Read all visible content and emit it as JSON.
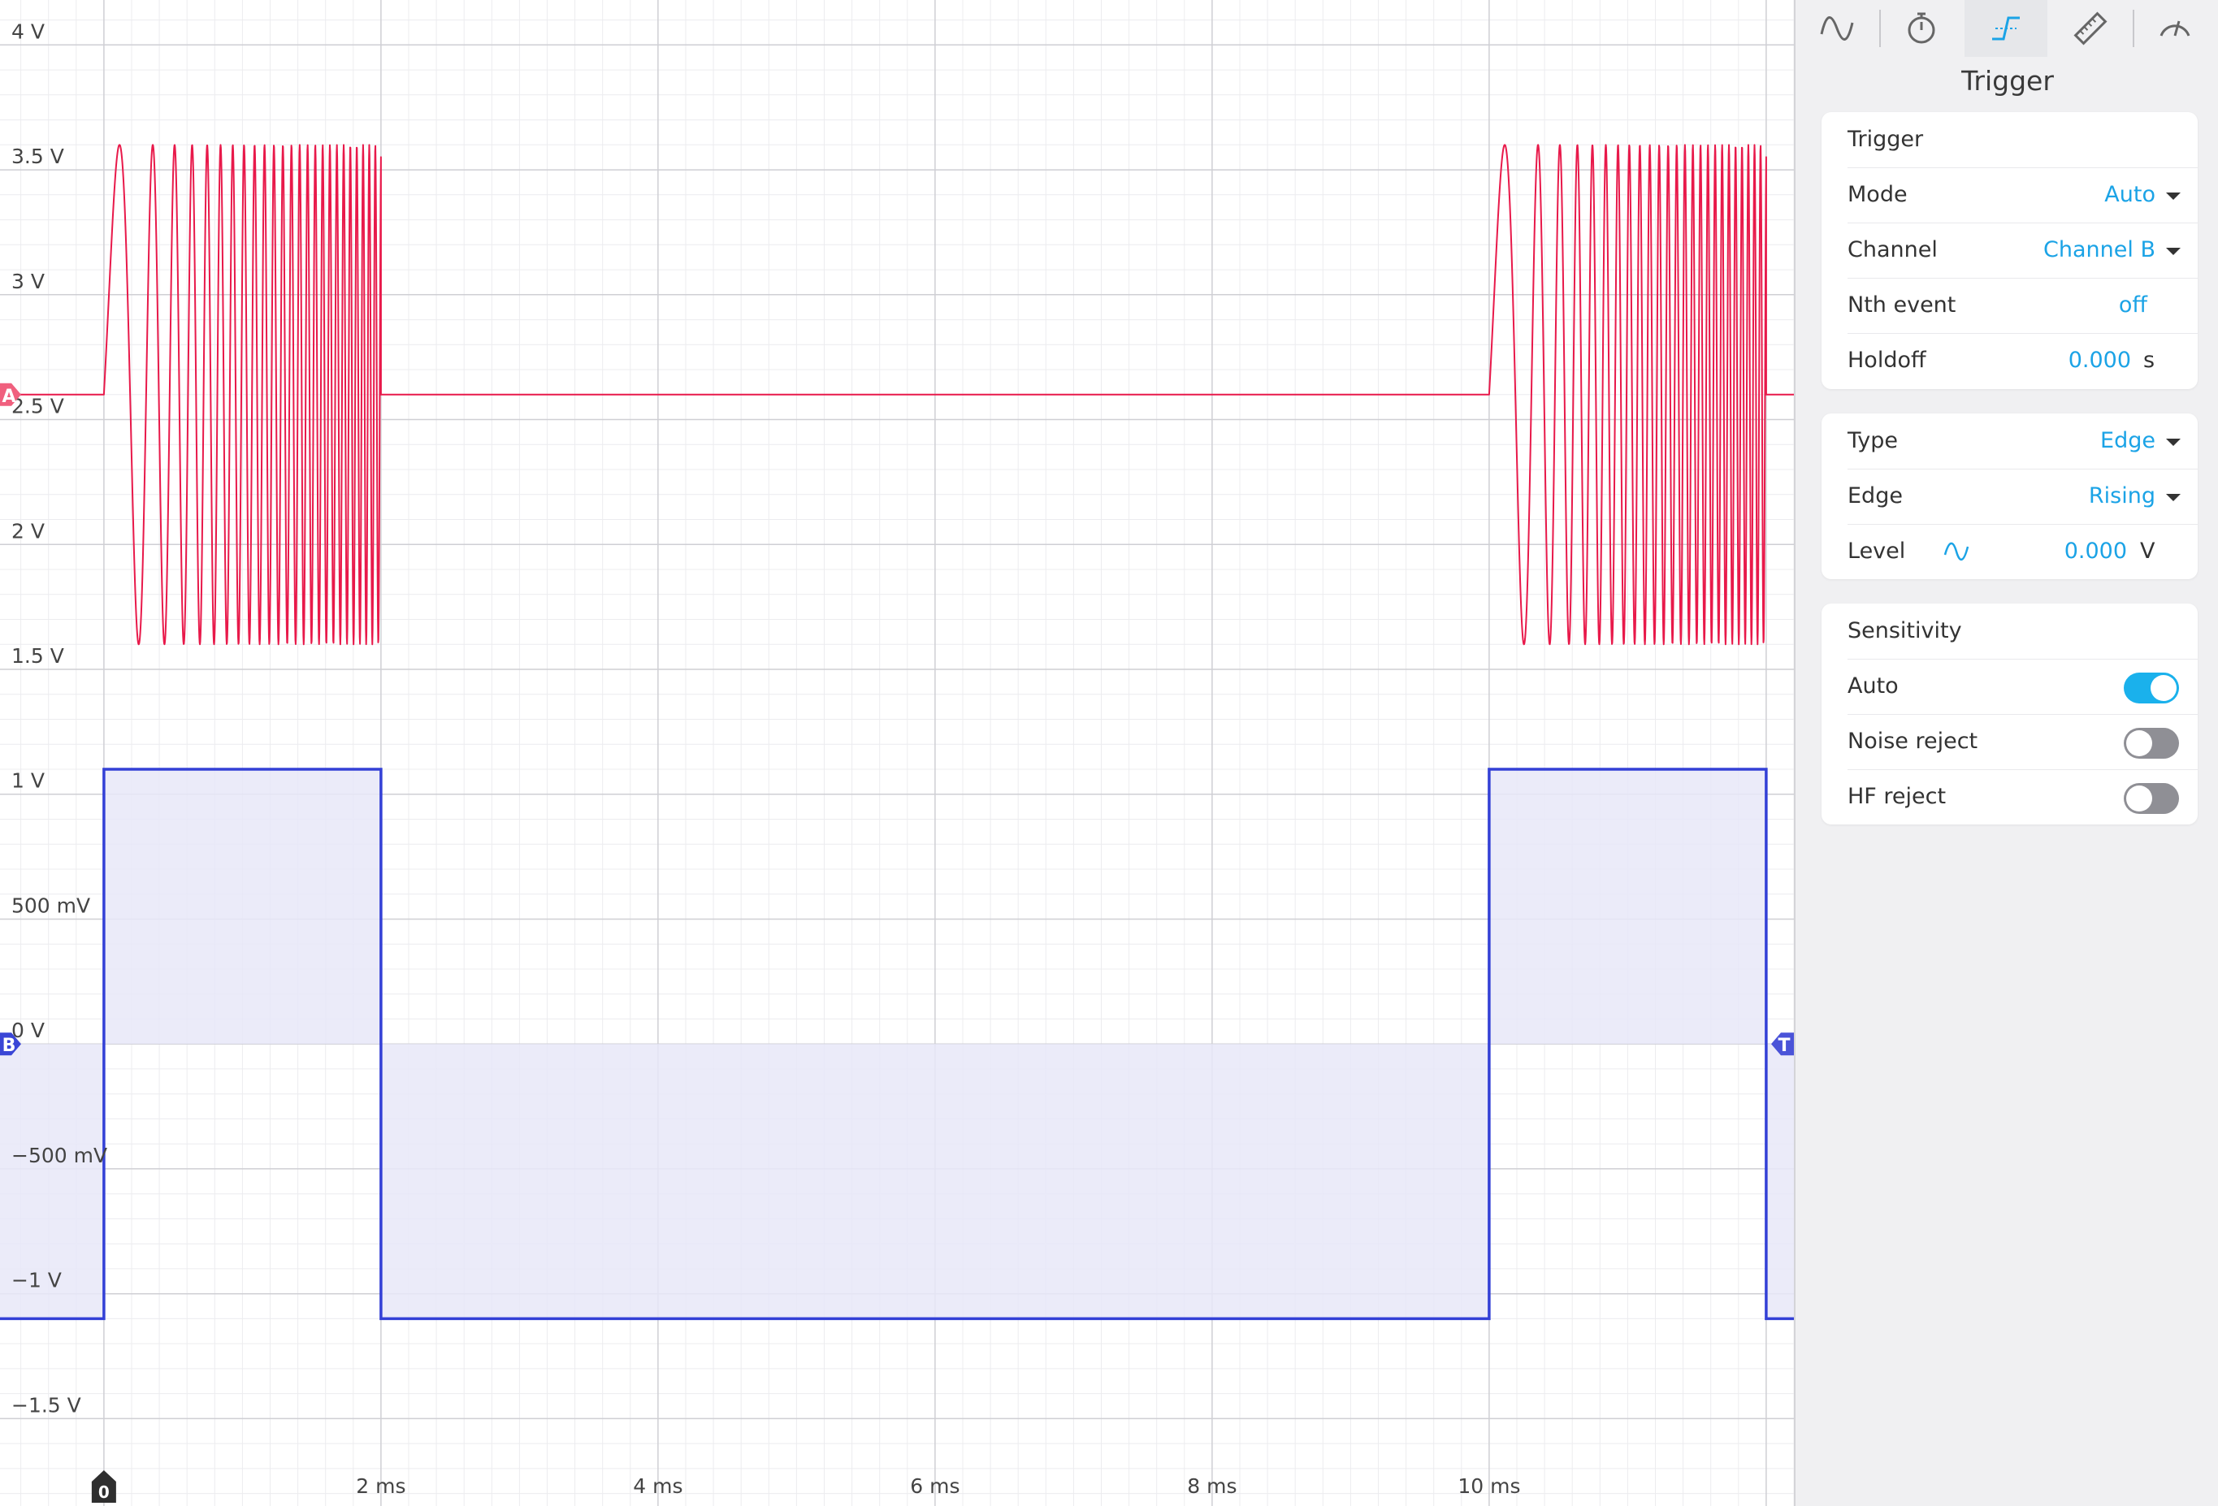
{
  "panel": {
    "tabs": [
      {
        "icon": "waveform-icon",
        "active": false
      },
      {
        "icon": "stopwatch-icon",
        "active": false
      },
      {
        "icon": "trigger-edge-icon",
        "active": true
      },
      {
        "icon": "ruler-icon",
        "active": false
      },
      {
        "icon": "gauge-icon",
        "active": false
      }
    ],
    "title": "Trigger",
    "trigger_card": {
      "heading": "Trigger",
      "mode_label": "Mode",
      "mode_value": "Auto",
      "channel_label": "Channel",
      "channel_value": "Channel B",
      "nth_label": "Nth event",
      "nth_value": "off",
      "holdoff_label": "Holdoff",
      "holdoff_value": "0.000",
      "holdoff_unit": "s"
    },
    "type_card": {
      "type_label": "Type",
      "type_value": "Edge",
      "edge_label": "Edge",
      "edge_value": "Rising",
      "level_label": "Level",
      "level_value": "0.000",
      "level_unit": "V"
    },
    "sensitivity_card": {
      "heading": "Sensitivity",
      "auto_label": "Auto",
      "auto_on": true,
      "noise_label": "Noise reject",
      "noise_on": false,
      "hf_label": "HF reject",
      "hf_on": false
    }
  },
  "chart_data": {
    "type": "line",
    "x_unit": "ms",
    "xlim": [
      -0.75,
      12.2
    ],
    "ylim": [
      -1.85,
      4.18
    ],
    "x_ticks": [
      {
        "v": 2,
        "label": "2 ms"
      },
      {
        "v": 4,
        "label": "4 ms"
      },
      {
        "v": 6,
        "label": "6 ms"
      },
      {
        "v": 8,
        "label": "8 ms"
      },
      {
        "v": 10,
        "label": "10 ms"
      }
    ],
    "y_ticks": [
      {
        "v": 4,
        "label": "4 V"
      },
      {
        "v": 3.5,
        "label": "3.5 V"
      },
      {
        "v": 3,
        "label": "3 V"
      },
      {
        "v": 2.5,
        "label": "2.5 V"
      },
      {
        "v": 2,
        "label": "2 V"
      },
      {
        "v": 1.5,
        "label": "1.5 V"
      },
      {
        "v": 1,
        "label": "1 V"
      },
      {
        "v": 0.5,
        "label": "500 mV"
      },
      {
        "v": 0,
        "label": "0 V"
      },
      {
        "v": -0.5,
        "label": "−500 mV"
      },
      {
        "v": -1,
        "label": "−1 V"
      },
      {
        "v": -1.5,
        "label": "−1.5 V"
      }
    ],
    "grid": true,
    "series": [
      {
        "name": "A",
        "color": "#e8194a",
        "baseline": 2.6,
        "burst_amplitude": 1.0,
        "bursts": [
          [
            0.0,
            2.0
          ],
          [
            10.0,
            12.0
          ]
        ],
        "marker_label": "A",
        "marker_color": "#f0607e"
      },
      {
        "name": "B",
        "color": "#3340d6",
        "fill": "#e8e8f8",
        "high": 1.1,
        "low": -1.1,
        "edges": [
          [
            -0.75,
            -1.1
          ],
          [
            0.0,
            1.1
          ],
          [
            2.0,
            -1.1
          ],
          [
            10.0,
            1.1
          ],
          [
            12.0,
            -1.1
          ],
          [
            12.2,
            -1.1
          ]
        ],
        "marker_label": "B",
        "marker_color": "#3a46d6"
      }
    ],
    "trigger_marker": {
      "label": "T",
      "y": 0,
      "color": "#4a53d8"
    },
    "time_zero_marker": {
      "label": "0",
      "x": 0,
      "color": "#2f2f2f"
    }
  }
}
